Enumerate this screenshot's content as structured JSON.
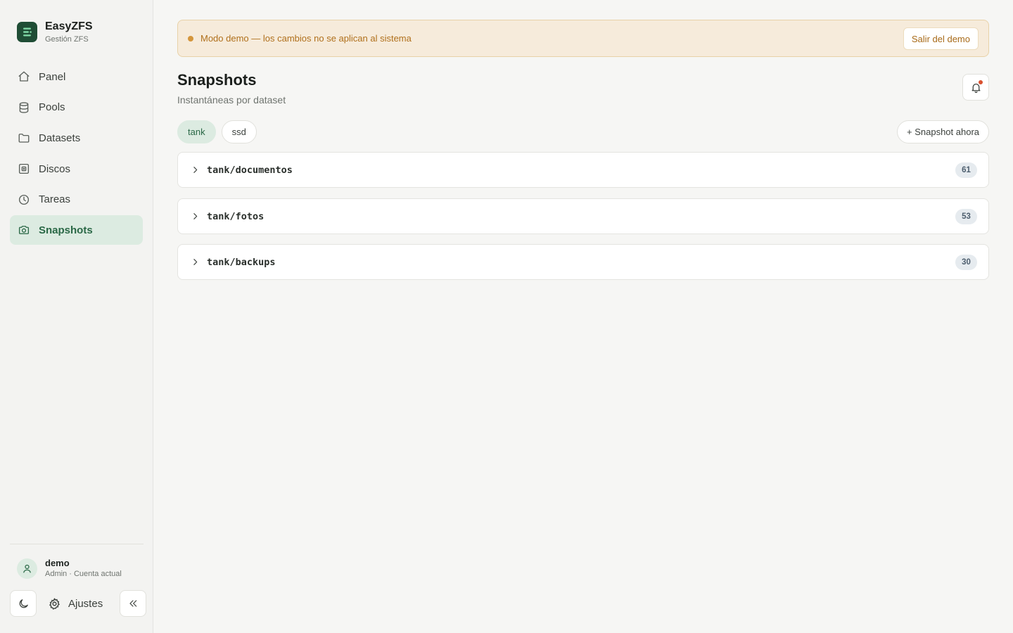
{
  "brand": {
    "title": "EasyZFS",
    "subtitle": "Gestión ZFS"
  },
  "sidebar": {
    "items": [
      {
        "label": "Panel",
        "icon": "home-icon",
        "active": false
      },
      {
        "label": "Pools",
        "icon": "database-icon",
        "active": false
      },
      {
        "label": "Datasets",
        "icon": "folder-icon",
        "active": false
      },
      {
        "label": "Discos",
        "icon": "disk-icon",
        "active": false
      },
      {
        "label": "Tareas",
        "icon": "clock-icon",
        "active": false
      },
      {
        "label": "Snapshots",
        "icon": "camera-icon",
        "active": true
      }
    ],
    "settings_label": "Ajustes"
  },
  "user": {
    "name": "demo",
    "role": "Admin · Cuenta actual"
  },
  "banner": {
    "text": "Modo demo — los cambios no se aplican al sistema",
    "exit_label": "Salir del demo"
  },
  "page": {
    "title": "Snapshots",
    "subtitle": "Instantáneas por dataset",
    "snapshot_now_label": "+ Snapshot ahora"
  },
  "pools": [
    {
      "label": "tank",
      "active": true
    },
    {
      "label": "ssd",
      "active": false
    }
  ],
  "datasets": [
    {
      "name": "tank/documentos",
      "count": "61"
    },
    {
      "name": "tank/fotos",
      "count": "53"
    },
    {
      "name": "tank/backups",
      "count": "30"
    }
  ],
  "colors": {
    "accent": "#2a6846",
    "accent_bg": "#dcebe1",
    "brand_dark": "#1f4d35",
    "warning_text": "#b0701c",
    "warning_bg": "#f6ebdb",
    "notification_dot": "#d9502f"
  }
}
